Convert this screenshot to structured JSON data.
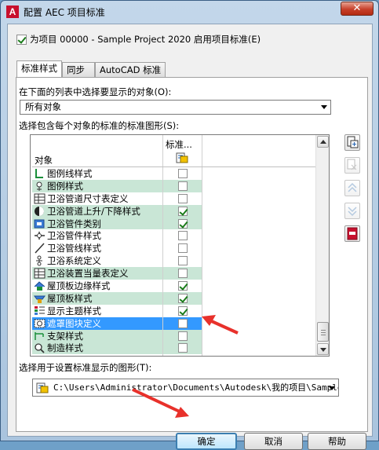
{
  "window": {
    "title": "配置 AEC 项目标准",
    "close_label": "✕"
  },
  "enable": {
    "label": "为项目 00000 - Sample Project 2020 启用项目标准(E)",
    "checked": true
  },
  "tabs": [
    {
      "label": "标准样式",
      "active": true
    },
    {
      "label": "同步",
      "active": false
    },
    {
      "label": "AutoCAD 标准",
      "active": false
    }
  ],
  "objects_label": "在下面的列表中选择要显示的对象(O):",
  "objects_combo": "所有对象",
  "drawing_label": "选择包含每个对象的标准的标准图形(S):",
  "list": {
    "col_object": "对象",
    "col_standard": "标准...",
    "rows": [
      {
        "name": "图例线样式",
        "icon": "legend-line-icon",
        "checked": false
      },
      {
        "name": "图例样式",
        "icon": "legend-icon",
        "checked": false
      },
      {
        "name": "卫浴管道尺寸表定义",
        "icon": "table-icon",
        "checked": false
      },
      {
        "name": "卫浴管道上升/下降样式",
        "icon": "rise-drop-icon",
        "checked": true
      },
      {
        "name": "卫浴管件类别",
        "icon": "fitting-category-icon",
        "checked": true
      },
      {
        "name": "卫浴管件样式",
        "icon": "fitting-style-icon",
        "checked": false
      },
      {
        "name": "卫浴管线样式",
        "icon": "pipe-line-icon",
        "checked": false
      },
      {
        "name": "卫浴系统定义",
        "icon": "system-icon",
        "checked": false
      },
      {
        "name": "卫浴装置当量表定义",
        "icon": "table-icon",
        "checked": false
      },
      {
        "name": "屋顶板边缘样式",
        "icon": "roof-edge-icon",
        "checked": true
      },
      {
        "name": "屋顶板样式",
        "icon": "roof-slab-icon",
        "checked": true
      },
      {
        "name": "显示主题样式",
        "icon": "display-theme-icon",
        "checked": true
      },
      {
        "name": "遮罩图块定义",
        "icon": "mask-block-icon",
        "checked": false,
        "selected": true
      },
      {
        "name": "支架样式",
        "icon": "support-icon",
        "checked": false
      },
      {
        "name": "制造样式",
        "icon": "fabrication-icon",
        "checked": false
      }
    ]
  },
  "display_label": "选择用于设置标准显示的图形(T):",
  "display_path": "C:\\Users\\Administrator\\Documents\\Autodesk\\我的项目\\Sample",
  "buttons": {
    "ok": "确定",
    "cancel": "取消",
    "help": "帮助"
  },
  "colors": {
    "row_alt": "#c9e6d6",
    "selection": "#3399ff",
    "annotation_arrow": "#e8312b"
  }
}
